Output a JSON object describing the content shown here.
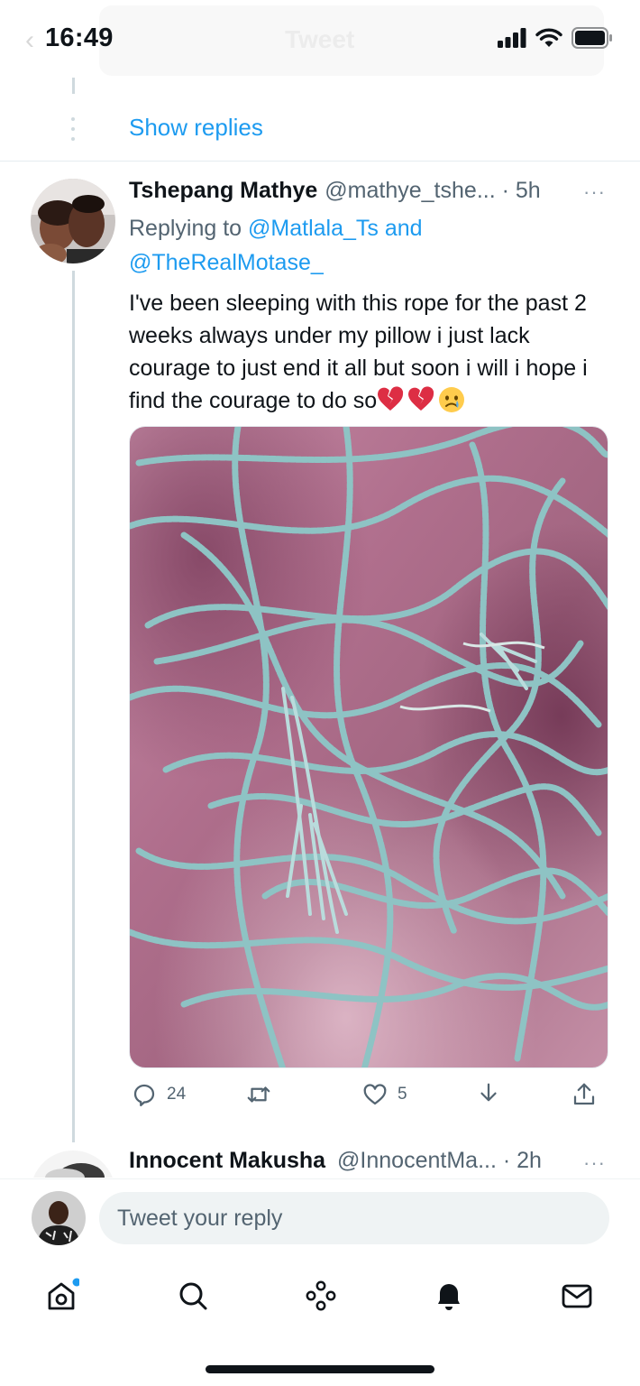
{
  "status_bar": {
    "time": "16:49"
  },
  "header": {
    "title": "Tweet"
  },
  "thread": {
    "show_replies_label": "Show replies"
  },
  "tweet": {
    "author_name": "Tshepang Mathye",
    "author_handle": "@mathye_tshe... · 5h",
    "more_label": "···",
    "replying_prefix": "Replying to",
    "replying_to_1": "@Matlala_Ts and",
    "replying_to_2": "@TheRealMotase_",
    "text": "I've been sleeping with this rope for the past 2 weeks always under my pillow i just lack courage to just end it all but soon i will i hope i find the courage to do so",
    "emojis": [
      "broken-heart-icon",
      "broken-heart-icon",
      "crying-face-icon"
    ],
    "media_alt": "Tangled light-blue rope on a pink fleece blanket",
    "actions": {
      "reply_count": "24",
      "retweet_count": "",
      "like_count": "5"
    }
  },
  "next_tweet": {
    "author_name": "Innocent Makusha",
    "author_handle": "@InnocentMa... · 2h",
    "more_label": "···"
  },
  "reply_bar": {
    "placeholder": "Tweet your reply"
  },
  "tab_bar": {
    "items": [
      "home-icon",
      "search-icon",
      "spaces-icon",
      "notifications-icon",
      "messages-icon"
    ]
  },
  "colors": {
    "accent": "#1d9bf0",
    "text": "#0f1419",
    "secondary": "#536471",
    "rope": "#8ec3c4",
    "blanket": "#b67a93"
  }
}
